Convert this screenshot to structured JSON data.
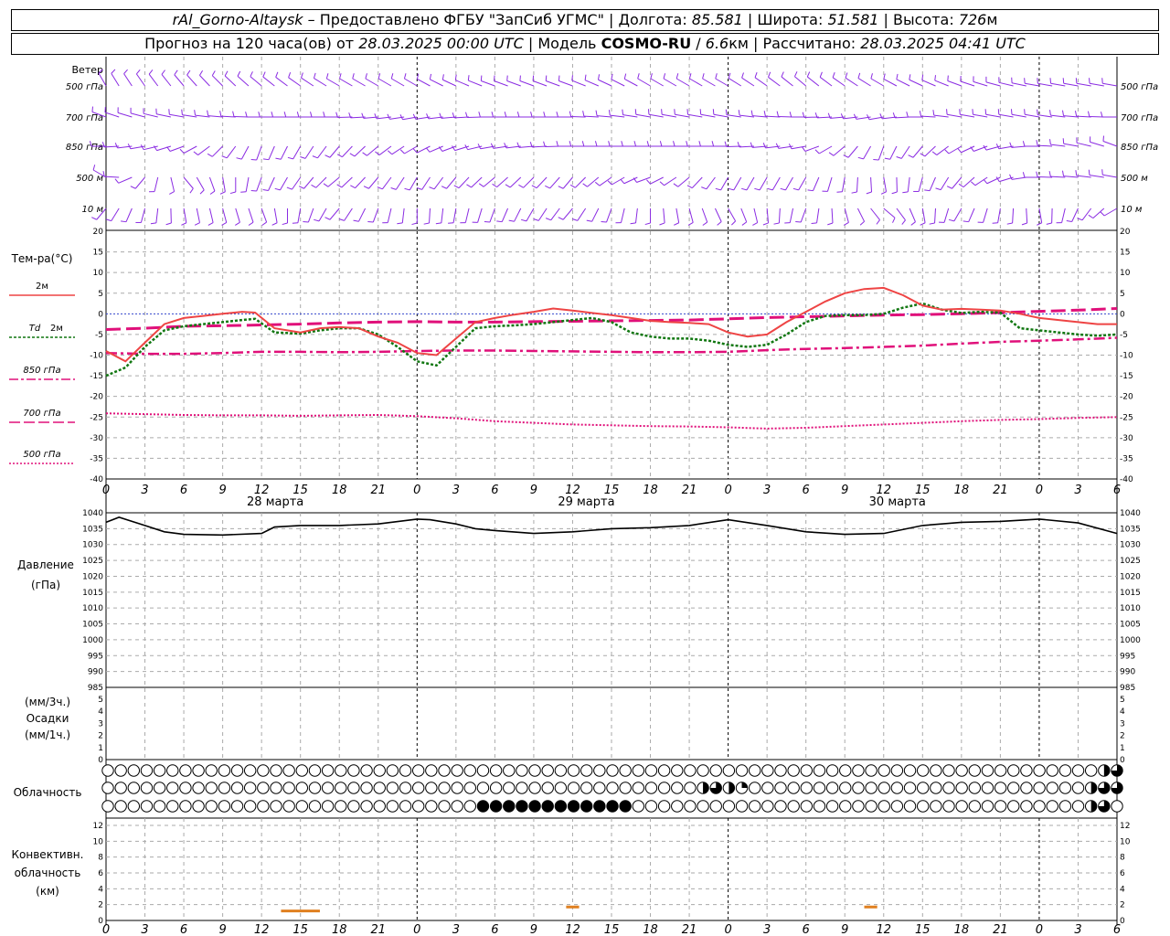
{
  "header": {
    "station": "rAl_Gorno-Altaysk",
    "dash": " – ",
    "provider": "Предоставлено ФГБУ \"ЗапСиб УГМС\"",
    "lon_label": "Долгота:",
    "lon": "85.581",
    "lat_label": "Широта:",
    "lat": "51.581",
    "alt_label": "Высота:",
    "alt": "726",
    "alt_unit": "м",
    "sep": " | ",
    "forecast_label": "Прогноз на 120 часа(ов) от",
    "forecast_time": "28.03.2025 00:00 UTC",
    "model_label": "Модель",
    "model": "COSMO-RU",
    "model_sep": " / ",
    "resolution": "6.6",
    "res_unit": "км",
    "calc_label": "Рассчитано:",
    "calc_time": "28.03.2025 04:41 UTC"
  },
  "labels": {
    "wind": "Ветер",
    "wind_levels": [
      "500 гПа",
      "700 гПа",
      "850 гПа",
      "500 м",
      "10 м"
    ],
    "temp": "Тем-ра(°C)",
    "t2m": "2м",
    "td_a": "Td",
    "td_b": "2м",
    "t850": "850 гПа",
    "t700": "700 гПа",
    "t500": "500 гПа",
    "pressure_a": "Давление",
    "pressure_b": "(гПа)",
    "precip_a": "(мм/3ч.)",
    "precip_b": "Осадки",
    "precip_c": "(мм/1ч.)",
    "cloud": "Облачность",
    "conv_a": "Конвективн.",
    "conv_b": "облачность",
    "conv_c": "(км)",
    "days": [
      "28 марта",
      "29 марта",
      "30 марта"
    ]
  },
  "colors": {
    "wind": "#8a2be2",
    "t2m": "#ee4444",
    "td": "#117711",
    "levels": "#e0107a",
    "conv": "#e08020",
    "grid": "#aaaaaa"
  },
  "chart_data": {
    "type": "line",
    "hour_ticks": [
      "0",
      "3",
      "6",
      "9",
      "12",
      "15",
      "18",
      "21",
      "0",
      "3",
      "6",
      "9",
      "12",
      "15",
      "18",
      "21",
      "0",
      "3",
      "6",
      "9",
      "12",
      "15",
      "18",
      "21",
      "0",
      "3",
      "6"
    ],
    "wind": {
      "levels": [
        "500 гПа",
        "700 гПа",
        "850 гПа",
        "500 м",
        "10 м"
      ],
      "hours": [
        0,
        6,
        12,
        18,
        24,
        30,
        36,
        42,
        48,
        54,
        60,
        66,
        72,
        78
      ],
      "direction_deg": [
        [
          330,
          320,
          310,
          300,
          300,
          290,
          290,
          300,
          300,
          310,
          300,
          290,
          280,
          280
        ],
        [
          290,
          280,
          270,
          270,
          260,
          270,
          270,
          280,
          280,
          270,
          260,
          280,
          280,
          270
        ],
        [
          270,
          250,
          200,
          220,
          240,
          260,
          270,
          270,
          270,
          260,
          200,
          240,
          270,
          290
        ],
        [
          300,
          140,
          200,
          230,
          210,
          230,
          220,
          250,
          210,
          210,
          170,
          220,
          270,
          280
        ],
        [
          220,
          170,
          160,
          220,
          180,
          200,
          220,
          180,
          150,
          200,
          130,
          210,
          170,
          240
        ]
      ]
    },
    "temperature": {
      "x_hours": [
        0,
        1.5,
        3,
        4.5,
        6,
        7.5,
        9,
        10.5,
        11.5,
        13,
        15,
        16.5,
        18,
        19.5,
        21,
        22.5,
        24,
        25.5,
        27,
        28.5,
        30,
        31.5,
        33,
        34.5,
        36,
        37.5,
        39,
        40.5,
        42,
        43.5,
        45,
        46.5,
        48,
        49.5,
        51,
        52.5,
        54,
        55.5,
        57,
        58.5,
        60,
        61.5,
        63,
        64.5,
        66,
        67.5,
        69,
        70.5,
        72,
        73.5,
        75,
        76.5,
        78
      ],
      "t2m": [
        -9,
        -11.5,
        -7,
        -2.5,
        -1,
        -0.5,
        0,
        0.5,
        0.3,
        -3.5,
        -4.5,
        -3.5,
        -3.2,
        -3.5,
        -5.5,
        -7,
        -9.5,
        -10,
        -6,
        -2,
        -1,
        -0.2,
        0.5,
        1.3,
        0.8,
        0.2,
        -0.3,
        -1,
        -1.7,
        -2,
        -2.2,
        -2.5,
        -4.5,
        -5.5,
        -5,
        -2,
        0.5,
        3,
        5,
        6,
        6.3,
        4.5,
        2,
        1,
        1.2,
        1,
        0.8,
        0,
        -1,
        -1.5,
        -2,
        -2.5,
        -2.5
      ],
      "td": [
        -15,
        -13,
        -8,
        -4,
        -3,
        -2.5,
        -2,
        -1.5,
        -1.2,
        -4.5,
        -4.8,
        -4,
        -3.5,
        -3.5,
        -5,
        -8,
        -11.5,
        -12.5,
        -8,
        -3.5,
        -3,
        -2.8,
        -2.5,
        -2,
        -1.5,
        -1,
        -2,
        -4.5,
        -5.5,
        -6,
        -6,
        -6.5,
        -7.5,
        -8,
        -7.5,
        -5,
        -2,
        -0.5,
        -0.3,
        -0.3,
        0,
        1.5,
        2.5,
        1,
        0.2,
        0.5,
        0.3,
        -3.5,
        -4,
        -4.5,
        -5,
        -5.3,
        -5
      ],
      "t850": [
        -9.5,
        -9.7,
        -9.7,
        -9.5,
        -9.2,
        -9.2,
        -9.3,
        -9.2,
        -9.0,
        -8.9,
        -8.9,
        -9.0,
        -9.1,
        -9.2,
        -9.3,
        -9.3,
        -9.2
      ],
      "t700": [
        -3.8,
        -3.5,
        -3.0,
        -2.9,
        -2.7,
        -2.5,
        -2.2,
        -2.0,
        -1.9,
        -2.0,
        -2.0,
        -1.9,
        -1.8,
        -1.7,
        -1.6,
        -1.5,
        -1.2
      ],
      "t500": [
        -24.1,
        -24.3,
        -24.5,
        -24.6,
        -24.6,
        -24.7,
        -24.6,
        -24.5,
        -24.8,
        -25.3,
        -26.0,
        -26.4,
        -26.8,
        -27.0,
        -27.2,
        -27.3,
        -27.5
      ],
      "level_hours": [
        0,
        3,
        6,
        9,
        12,
        15,
        18,
        21,
        24,
        27,
        30,
        33,
        36,
        39,
        42,
        45,
        48
      ],
      "ylim": [
        -40,
        20
      ]
    },
    "temperature_late": {
      "level_hours": [
        48,
        51,
        54,
        57,
        60,
        63,
        66,
        69,
        72,
        75,
        78
      ],
      "t850": [
        -9.2,
        -8.8,
        -8.5,
        -8.3,
        -8.0,
        -7.7,
        -7.2,
        -6.8,
        -6.5,
        -6.2,
        -5.8
      ],
      "t700": [
        -1.2,
        -0.9,
        -0.7,
        -0.5,
        -0.3,
        -0.2,
        0.0,
        0.3,
        0.6,
        0.9,
        1.3
      ],
      "t500": [
        -27.5,
        -27.8,
        -27.6,
        -27.2,
        -26.8,
        -26.4,
        -26.0,
        -25.7,
        -25.5,
        -25.2,
        -25.0
      ]
    },
    "pressure": {
      "x_hours": [
        0,
        1,
        3,
        4.5,
        6,
        9,
        12,
        13,
        15,
        18,
        21,
        24,
        25,
        27,
        28.5,
        30,
        33,
        36,
        39,
        42,
        45,
        48,
        51,
        54,
        57,
        60,
        63,
        66,
        69,
        72,
        75,
        78
      ],
      "values": [
        1037,
        1038.6,
        1036,
        1034,
        1033.2,
        1033,
        1033.5,
        1035.5,
        1036,
        1036,
        1036.5,
        1038,
        1037.8,
        1036.5,
        1035,
        1034.4,
        1033.5,
        1034,
        1035,
        1035.3,
        1036,
        1037.8,
        1036,
        1034,
        1033.2,
        1033.5,
        1036,
        1037,
        1037.3,
        1038,
        1036.8,
        1033.5
      ],
      "ylim": [
        985,
        1040
      ],
      "ticks": [
        "1040",
        "1035",
        "1030",
        "1025",
        "1020",
        "1015",
        "1010",
        "1005",
        "1000",
        "995",
        "990",
        "985"
      ]
    },
    "precip": {
      "ticks": [
        "5",
        "4",
        "3",
        "2",
        "1",
        "0"
      ],
      "values_mm": []
    },
    "clouds": {
      "rows": [
        "high",
        "middle",
        "low"
      ],
      "step_hours": 1,
      "high": [
        0,
        0,
        0,
        0,
        0,
        0,
        0,
        0,
        0,
        0,
        0,
        0,
        0,
        0,
        0,
        0,
        0,
        0,
        0,
        0,
        0,
        0,
        0,
        0,
        0,
        0,
        0,
        0,
        0,
        0,
        0,
        0,
        0,
        0,
        0,
        0,
        0,
        0,
        0,
        0,
        0,
        0,
        0,
        0,
        0,
        0,
        0,
        0,
        0,
        0,
        0,
        0,
        0,
        0,
        0,
        0,
        0,
        0,
        0,
        0,
        0,
        0,
        0,
        0,
        0,
        0,
        0,
        0,
        0,
        0,
        0,
        0,
        0,
        0,
        0,
        0,
        0,
        0,
        0,
        0,
        0,
        0,
        0,
        0,
        0,
        0,
        0,
        0,
        0,
        0,
        0,
        0,
        0,
        0,
        0,
        0,
        0,
        0,
        0,
        0,
        0,
        0,
        0,
        0,
        0,
        0,
        0,
        0,
        0,
        0,
        0,
        0,
        0,
        0,
        0,
        0,
        0,
        0,
        0,
        0,
        0,
        0,
        0,
        0,
        0,
        0,
        0,
        0,
        0,
        0,
        0,
        0,
        0,
        0,
        0,
        0,
        0,
        0,
        0,
        0,
        0,
        0,
        0,
        0,
        0,
        0,
        0,
        0,
        0,
        0,
        0,
        0,
        0,
        0,
        0,
        0,
        0,
        0,
        0,
        0,
        0,
        0,
        0,
        0,
        0,
        0,
        0,
        0,
        0,
        0,
        0,
        0,
        0,
        0,
        0,
        0,
        0,
        0,
        0,
        0,
        0,
        0,
        0,
        0,
        0,
        0,
        0,
        0,
        0,
        0,
        0,
        0,
        0,
        0,
        0,
        0,
        0,
        0,
        0,
        0,
        0,
        0,
        0,
        0,
        0,
        0,
        0,
        0,
        0,
        0,
        0,
        0,
        0,
        0,
        0,
        0,
        0,
        0,
        0,
        0,
        0,
        0,
        0,
        0,
        0,
        0,
        0,
        0,
        0,
        0,
        0,
        0,
        0,
        0,
        0,
        0,
        0,
        0,
        0,
        0,
        0,
        0,
        0,
        0,
        0,
        0,
        0,
        0,
        0,
        0,
        0,
        0,
        0,
        0,
        0,
        0,
        0,
        0,
        0,
        0,
        0,
        0,
        0,
        0,
        0,
        0,
        0,
        0,
        0,
        0,
        0,
        0,
        0,
        0,
        0,
        0,
        0,
        0,
        0,
        0,
        0,
        0,
        0,
        0,
        0,
        0,
        0,
        0,
        0,
        0,
        0,
        0,
        0,
        0,
        0,
        0,
        0,
        0,
        0,
        0,
        0
      ],
      "fractions": {
        "high": [
          0,
          0,
          0,
          0,
          0,
          0,
          0,
          0,
          0,
          0,
          0,
          0,
          0,
          0,
          0,
          0,
          0,
          0,
          0,
          0,
          0,
          0,
          0,
          0,
          0,
          0,
          0,
          0,
          0,
          0,
          0,
          0,
          0,
          0,
          0,
          0,
          0,
          0,
          0,
          0,
          0,
          0,
          0,
          0,
          0,
          0,
          0,
          0,
          0,
          0,
          0,
          0,
          0,
          0,
          0,
          0,
          0,
          0,
          0,
          0,
          0,
          0,
          0,
          0,
          0,
          0,
          0,
          0,
          0,
          0,
          0,
          0,
          0,
          0,
          0,
          0,
          0,
          0.5,
          0.75,
          0.25,
          0.75,
          0.25,
          0,
          0,
          0,
          0,
          0,
          0,
          0,
          0,
          0,
          0,
          0,
          0,
          0,
          0,
          0,
          0,
          0,
          0,
          0,
          0,
          0,
          0,
          0,
          0,
          0,
          0,
          0,
          0,
          0,
          0,
          0,
          0,
          0.5,
          0,
          0,
          0,
          0,
          0.75,
          0.75,
          0.75,
          0.5,
          0,
          0,
          0,
          0,
          0,
          0,
          0,
          0.5,
          0,
          0,
          0,
          0,
          0,
          0.75,
          0.25,
          0,
          0,
          0.5,
          0.5,
          0,
          0,
          0,
          0,
          0,
          0,
          0,
          0,
          0,
          0,
          0,
          0,
          0,
          0,
          0,
          0,
          0,
          0
        ],
        "middle": [
          0,
          0,
          0,
          0,
          0,
          0,
          0,
          0,
          0,
          0,
          0,
          0,
          0,
          0,
          0,
          0,
          0,
          0,
          0,
          0,
          0,
          0,
          0,
          0,
          0,
          0,
          0,
          0,
          0,
          0,
          0,
          0,
          0,
          0,
          0,
          0,
          0,
          0,
          0,
          0,
          0,
          0,
          0,
          0,
          0,
          0,
          0.5,
          0.75,
          0.5,
          0.25,
          0,
          0,
          0,
          0,
          0,
          0,
          0,
          0,
          0,
          0,
          0,
          0,
          0,
          0,
          0,
          0,
          0,
          0,
          0,
          0,
          0,
          0,
          0,
          0,
          0,
          0,
          0.5,
          0.75,
          0.75,
          0.75,
          0.75,
          0.75,
          0.5,
          0.25,
          0.5,
          0.5,
          0.25,
          0.5,
          0.25,
          0,
          0,
          0,
          0,
          0,
          0,
          0,
          0,
          0,
          0,
          0,
          0,
          0,
          0,
          0,
          0,
          0.5,
          0.5,
          0.25,
          0.75,
          0.75,
          1,
          1,
          1,
          1,
          1,
          1,
          0.75,
          0.75,
          0.25,
          0.75,
          0.75,
          0.75,
          0.5,
          0.5,
          0.25,
          0.5,
          0.5,
          0.5,
          0,
          0
        ],
        "low": [
          0,
          0,
          0,
          0,
          0,
          0,
          0,
          0,
          0,
          0,
          0,
          0,
          0,
          0,
          0,
          0,
          0,
          0,
          0,
          0,
          0,
          0,
          0,
          0,
          0,
          0,
          0,
          0,
          0,
          1,
          1,
          1,
          1,
          1,
          1,
          1,
          1,
          1,
          1,
          1,
          1,
          0,
          0,
          0,
          0,
          0,
          0,
          0,
          0,
          0,
          0,
          0,
          0,
          0,
          0,
          0,
          0,
          0,
          0,
          0,
          0,
          0,
          0,
          0,
          0,
          0,
          0,
          0,
          0,
          0,
          0,
          0,
          0,
          0,
          0,
          0,
          0.5,
          0.75,
          0,
          0,
          0,
          0,
          0,
          0,
          0,
          0,
          0,
          0,
          0,
          0,
          0,
          0,
          0,
          0,
          0,
          0,
          0,
          0,
          0,
          0,
          0,
          0,
          0,
          0,
          0,
          0,
          0,
          0,
          0,
          0,
          0,
          0,
          0,
          0,
          0,
          0,
          0,
          0.5,
          0,
          0,
          0,
          0,
          0,
          0,
          0,
          0,
          0,
          0,
          0,
          0,
          0,
          0,
          0,
          0,
          0,
          0,
          0,
          0,
          0,
          0,
          0,
          0,
          0,
          0,
          0,
          0,
          0,
          0,
          0,
          0,
          0,
          0,
          0,
          0,
          0,
          0,
          0,
          0,
          0,
          0,
          0,
          0
        ]
      },
      "circles_per_row": 79
    },
    "convective": {
      "ticks": [
        "12",
        "10",
        "8",
        "6",
        "4",
        "2",
        "0"
      ],
      "segments": [
        {
          "start_h": 13.5,
          "end_h": 16.5,
          "km": 1.2
        },
        {
          "start_h": 35.5,
          "end_h": 36.5,
          "km": 1.7
        },
        {
          "start_h": 58.5,
          "end_h": 59.5,
          "km": 1.7
        }
      ],
      "ylim": [
        0,
        13
      ]
    }
  }
}
